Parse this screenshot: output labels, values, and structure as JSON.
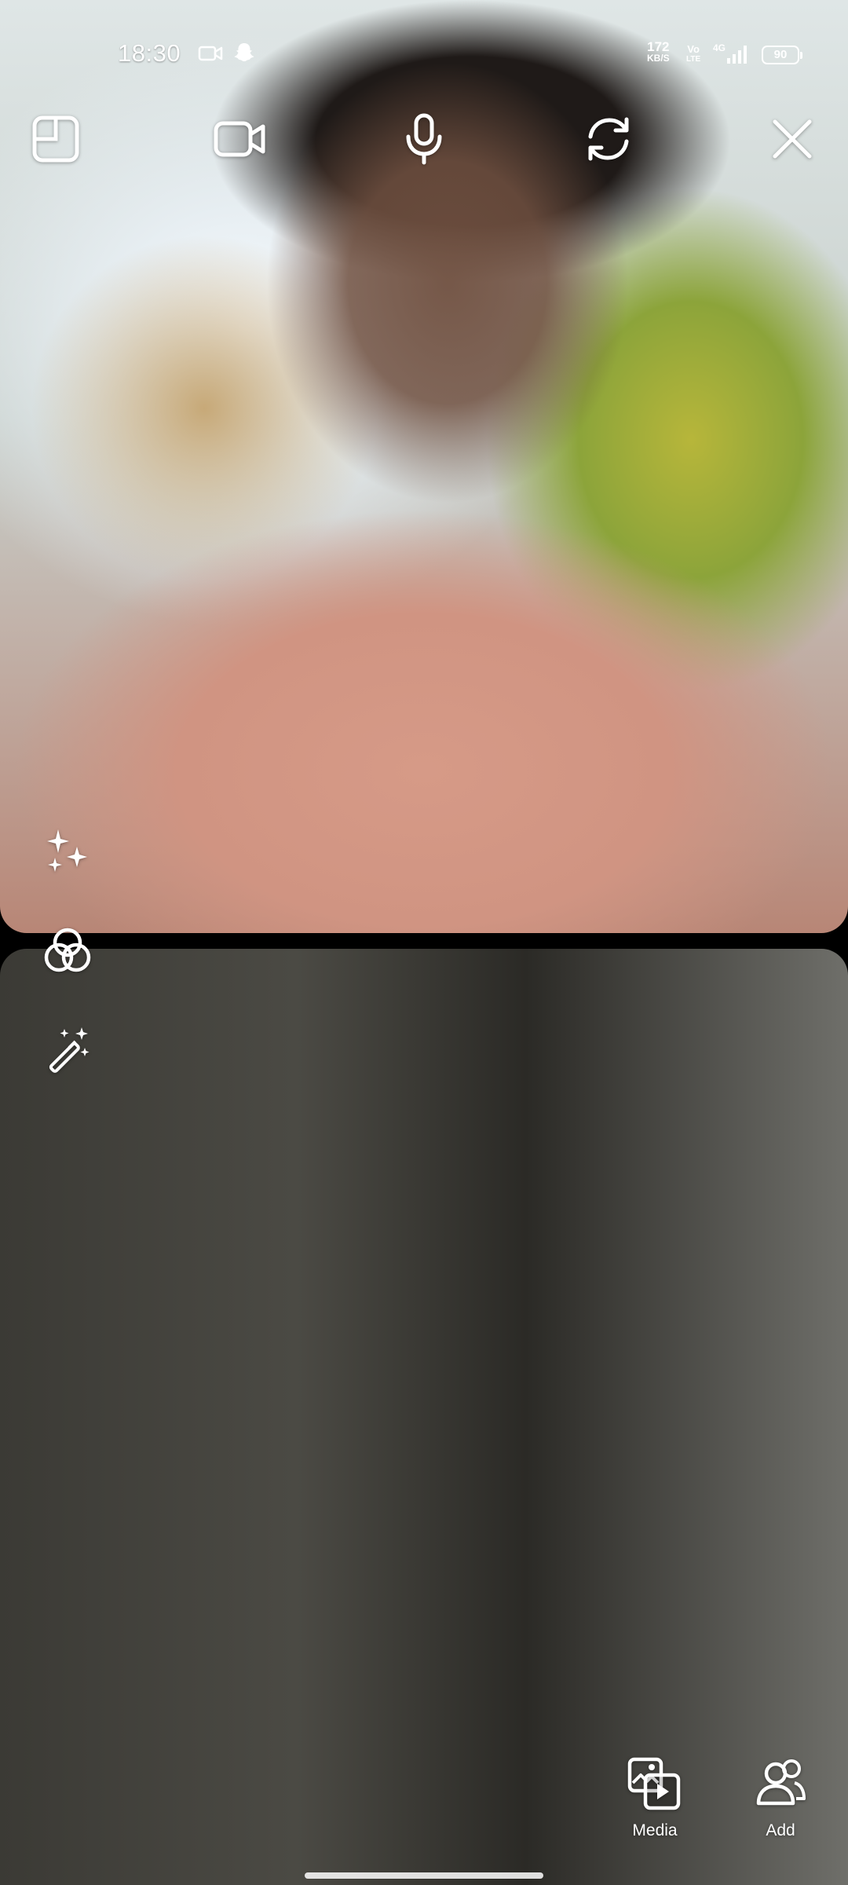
{
  "status_bar": {
    "time": "18:30",
    "net_speed_value": "172",
    "net_speed_unit": "KB/S",
    "volte_top": "Vo",
    "volte_bottom": "LTE",
    "network": "4G",
    "battery": "90",
    "icons": [
      "screen-record-icon",
      "snapchat-ghost-icon",
      "signal-icon"
    ]
  },
  "top_controls": [
    {
      "name": "layout-button",
      "icon": "layout-icon"
    },
    {
      "name": "camera-toggle-button",
      "icon": "video-camera-icon"
    },
    {
      "name": "microphone-button",
      "icon": "microphone-icon"
    },
    {
      "name": "flip-camera-button",
      "icon": "flip-camera-icon"
    },
    {
      "name": "end-call-button",
      "icon": "close-icon"
    }
  ],
  "side_effects": [
    {
      "name": "effects-button",
      "icon": "sparkles-icon"
    },
    {
      "name": "filters-button",
      "icon": "color-filter-icon"
    },
    {
      "name": "magic-wand-button",
      "icon": "magic-wand-icon"
    }
  ],
  "actions": {
    "media": {
      "label": "Media",
      "icon": "media-icon"
    },
    "add": {
      "label": "Add",
      "icon": "add-friend-icon"
    }
  }
}
